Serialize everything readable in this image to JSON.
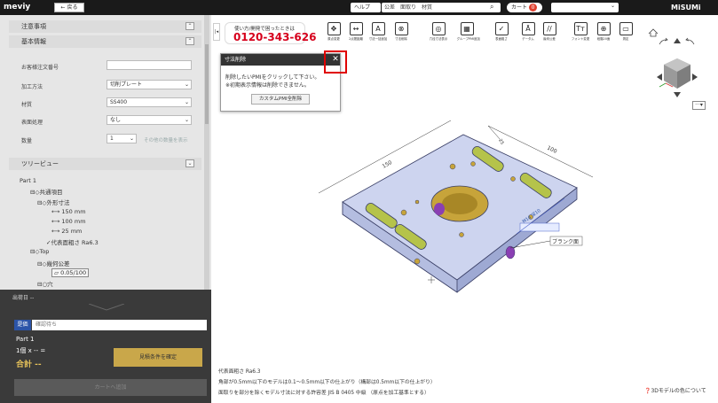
{
  "header": {
    "logo": "meviy",
    "back_label": "← 戻る",
    "help_dropdown": "ヘルプ",
    "search_value": "公差　面取り　材質",
    "cart_label": "カート",
    "cart_count": "0",
    "user_dropdown": "",
    "brand": "MiSUMi"
  },
  "sidebar": {
    "section1": "注意事項",
    "section2": "基本情報",
    "fields": [
      {
        "label": "お客様注文番号",
        "value": ""
      },
      {
        "label": "加工方法",
        "value": "切削プレート"
      },
      {
        "label": "材質",
        "value": "SS400"
      },
      {
        "label": "表面処理",
        "value": "なし"
      },
      {
        "label": "数量",
        "value": "1"
      }
    ],
    "qty_hint": "その他の数量を表示",
    "tree_head": "ツリービュー",
    "tree": [
      "Part 1",
      "共通項目",
      "外形寸法",
      "150 mm",
      "100 mm",
      "25 mm",
      "代表面粗さ Ra6.3",
      "Top",
      "幾何公差",
      "0.05/100",
      "穴"
    ]
  },
  "bottom": {
    "status_head": "出荷日 --",
    "status_badge": "是価",
    "status_field": "確認待ち",
    "part_name": "Part 1",
    "qty_line": "1個 x -- =",
    "total": "合計 --",
    "confirm_btn": "見積条件を確定",
    "cart_add_btn": "カートへ追加"
  },
  "phone": {
    "sub": "使い方/開発で困ったときは",
    "number": "0120-343-626"
  },
  "toolbar": [
    {
      "icon": "✥",
      "label": "原点変更"
    },
    {
      "icon": "↔",
      "label": "2点間距離"
    },
    {
      "icon": "A",
      "label": "寸法一括追加"
    },
    {
      "icon": "⊗",
      "label": "寸法削除"
    },
    {
      "icon": "◎",
      "label": "穴径寸法表示"
    },
    {
      "icon": "▦",
      "label": "グループPMI追加"
    },
    {
      "icon": "✓",
      "label": "表面粗さ"
    },
    {
      "icon": "Ā",
      "label": "データム"
    },
    {
      "icon": "//",
      "label": "幾何公差"
    },
    {
      "icon": "Tт",
      "label": "フォント変更"
    },
    {
      "icon": "⊕",
      "label": "段階20面"
    },
    {
      "icon": "▭",
      "label": "測定"
    }
  ],
  "popup": {
    "title": "寸法削除",
    "close": "✕",
    "msg1": "削除したいPMIをクリックして下さい。",
    "msg2": "※初期表示情報は削除できません。",
    "button": "カスタムPMI全削除"
  },
  "model": {
    "dim_150": "150",
    "dim_100": "100",
    "dim_25": "25",
    "thread": "M14 深10",
    "blank_label": "ブランク面"
  },
  "notes": [
    "代表面粗さ Ra6.3",
    "角部が0.5mm以下のモデルは0.1〜0.5mm以下の仕上がり（構部は0.5mm以下の仕上がり）",
    "面取りを部分を除くモデル寸法に対する許容差 JIS B 0405 中級 （原点を加工基準とする）"
  ],
  "help_link": "3Dモデルの色について",
  "colors": {
    "accent": "#2b54a8",
    "phone": "#d6001c",
    "part": "#c5cde9",
    "hole": "#c7a43a"
  }
}
